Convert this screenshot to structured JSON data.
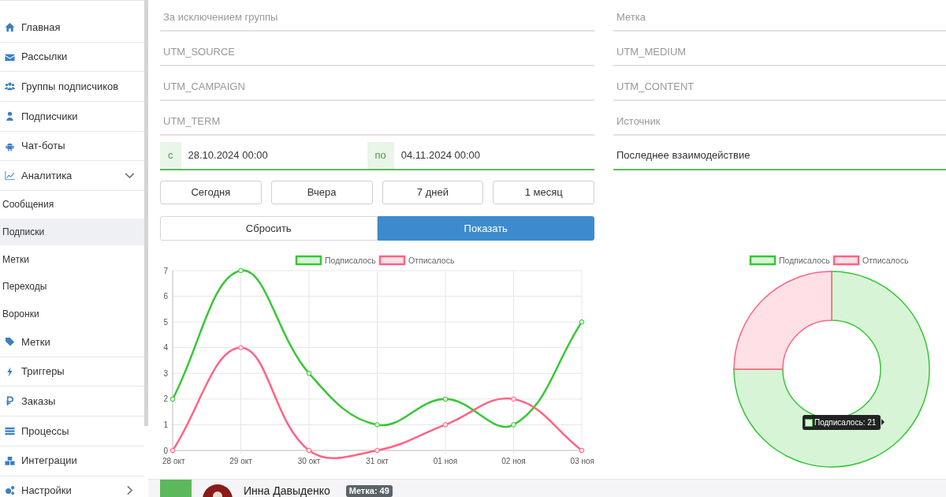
{
  "sidebar": {
    "items": [
      {
        "label": "Главная"
      },
      {
        "label": "Рассылки"
      },
      {
        "label": "Группы подписчиков"
      },
      {
        "label": "Подписчики"
      },
      {
        "label": "Чат-боты"
      },
      {
        "label": "Аналитика",
        "expanded": true,
        "children": [
          {
            "label": "Сообщения",
            "selected": false
          },
          {
            "label": "Подписки",
            "selected": true
          },
          {
            "label": "Метки",
            "selected": false
          },
          {
            "label": "Переходы",
            "selected": false
          },
          {
            "label": "Воронки",
            "selected": false
          }
        ]
      },
      {
        "label": "Метки"
      },
      {
        "label": "Триггеры"
      },
      {
        "label": "Заказы"
      },
      {
        "label": "Процессы"
      },
      {
        "label": "Интеграции"
      },
      {
        "label": "Настройки",
        "expanded": false
      }
    ]
  },
  "filters": {
    "fields": [
      {
        "placeholder": "За исключением группы"
      },
      {
        "placeholder": "Метка"
      },
      {
        "placeholder": "UTM_SOURCE"
      },
      {
        "placeholder": "UTM_MEDIUM"
      },
      {
        "placeholder": "UTM_CAMPAIGN"
      },
      {
        "placeholder": "UTM_CONTENT"
      },
      {
        "placeholder": "UTM_TERM"
      },
      {
        "placeholder": "Источник"
      }
    ],
    "date_range": {
      "from_label": "с",
      "from": "28.10.2024 00:00",
      "to_label": "по",
      "to": "04.11.2024 00:00"
    },
    "sort": {
      "value": "Последнее взаимодействие"
    },
    "period_buttons": [
      "Сегодня",
      "Вчера",
      "7 дней",
      "1 месяц"
    ],
    "reset_button": "Сбросить",
    "show_button": "Показать"
  },
  "line_chart": {
    "chart_data": {
      "type": "line",
      "categories": [
        "28 окт",
        "29 окт",
        "30 окт",
        "31 окт",
        "01 ноя",
        "02 ноя",
        "03 ноя"
      ],
      "series": [
        {
          "name": "Подписалось",
          "color": "#36c736",
          "values": [
            2,
            7,
            3,
            1,
            2,
            1,
            5
          ],
          "marker": "circle"
        },
        {
          "name": "Отписалось",
          "color": "#ff6384",
          "values": [
            0,
            4,
            0,
            0,
            1,
            2,
            0
          ],
          "marker": "circle"
        }
      ],
      "ylim": [
        0,
        7
      ],
      "yticks": [
        0,
        1,
        2,
        3,
        4,
        5,
        6,
        7
      ],
      "grid": true,
      "legend": true
    }
  },
  "donut_chart": {
    "chart_data": {
      "type": "donut",
      "categories": [
        "Подписалось",
        "Отписалось"
      ],
      "values": [
        75,
        25
      ],
      "colors": [
        "#36c736",
        "#ff6384"
      ],
      "legend": true
    },
    "tooltip": "Подписалось: 21"
  },
  "subscriber_row": {
    "name": "Инна Давыденко",
    "tag": "Метка: 49"
  }
}
